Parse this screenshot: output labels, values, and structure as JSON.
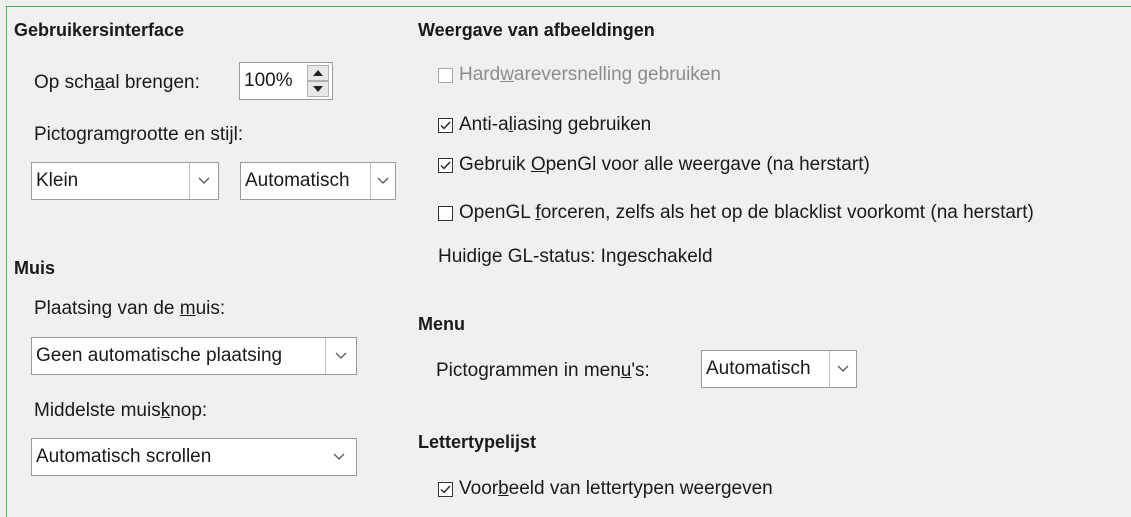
{
  "ui": {
    "title": "Gebruikersinterface",
    "scale_label_pre": "Op sch",
    "scale_label_ul": "a",
    "scale_label_post": "al brengen:",
    "scale_value": "100%",
    "icon_label_pre": "Pictogram",
    "icon_label_ul": "g",
    "icon_label_post": "rootte en stijl:",
    "icon_size_value": "Klein",
    "icon_style_value": "Automatisch"
  },
  "mouse": {
    "title": "Muis",
    "position_label_pre": "Plaatsing van de ",
    "position_label_ul": "m",
    "position_label_post": "uis:",
    "position_value": "Geen automatische plaatsing",
    "middle_label_pre": "Middelste muis",
    "middle_label_ul": "k",
    "middle_label_post": "nop:",
    "middle_value": "Automatisch scrollen"
  },
  "graphics": {
    "title": "Weergave van afbeeldingen",
    "hw_pre": "Hard",
    "hw_ul": "w",
    "hw_post": "areversnelling gebruiken",
    "hw_checked": false,
    "aa_pre": "Anti-a",
    "aa_ul": "l",
    "aa_post": "iasing gebruiken",
    "aa_checked": true,
    "gl_pre": "Gebruik ",
    "gl_ul": "O",
    "gl_post": "penGl voor alle weergave (na herstart)",
    "gl_checked": true,
    "force_pre": "OpenGL ",
    "force_ul": "f",
    "force_post": "orceren, zelfs als het op de blacklist voorkomt (na herstart)",
    "force_checked": false,
    "status": "Huidige GL-status: Ingeschakeld"
  },
  "menu": {
    "title": "Menu",
    "icons_label_pre": "Pictogrammen in men",
    "icons_label_ul": "u",
    "icons_label_post": "'s:",
    "icons_value": "Automatisch"
  },
  "fontlist": {
    "title": "Lettertypelijst",
    "preview_pre": "Voor",
    "preview_ul": "b",
    "preview_post": "eeld van lettertypen weergeven",
    "preview_checked": true
  }
}
